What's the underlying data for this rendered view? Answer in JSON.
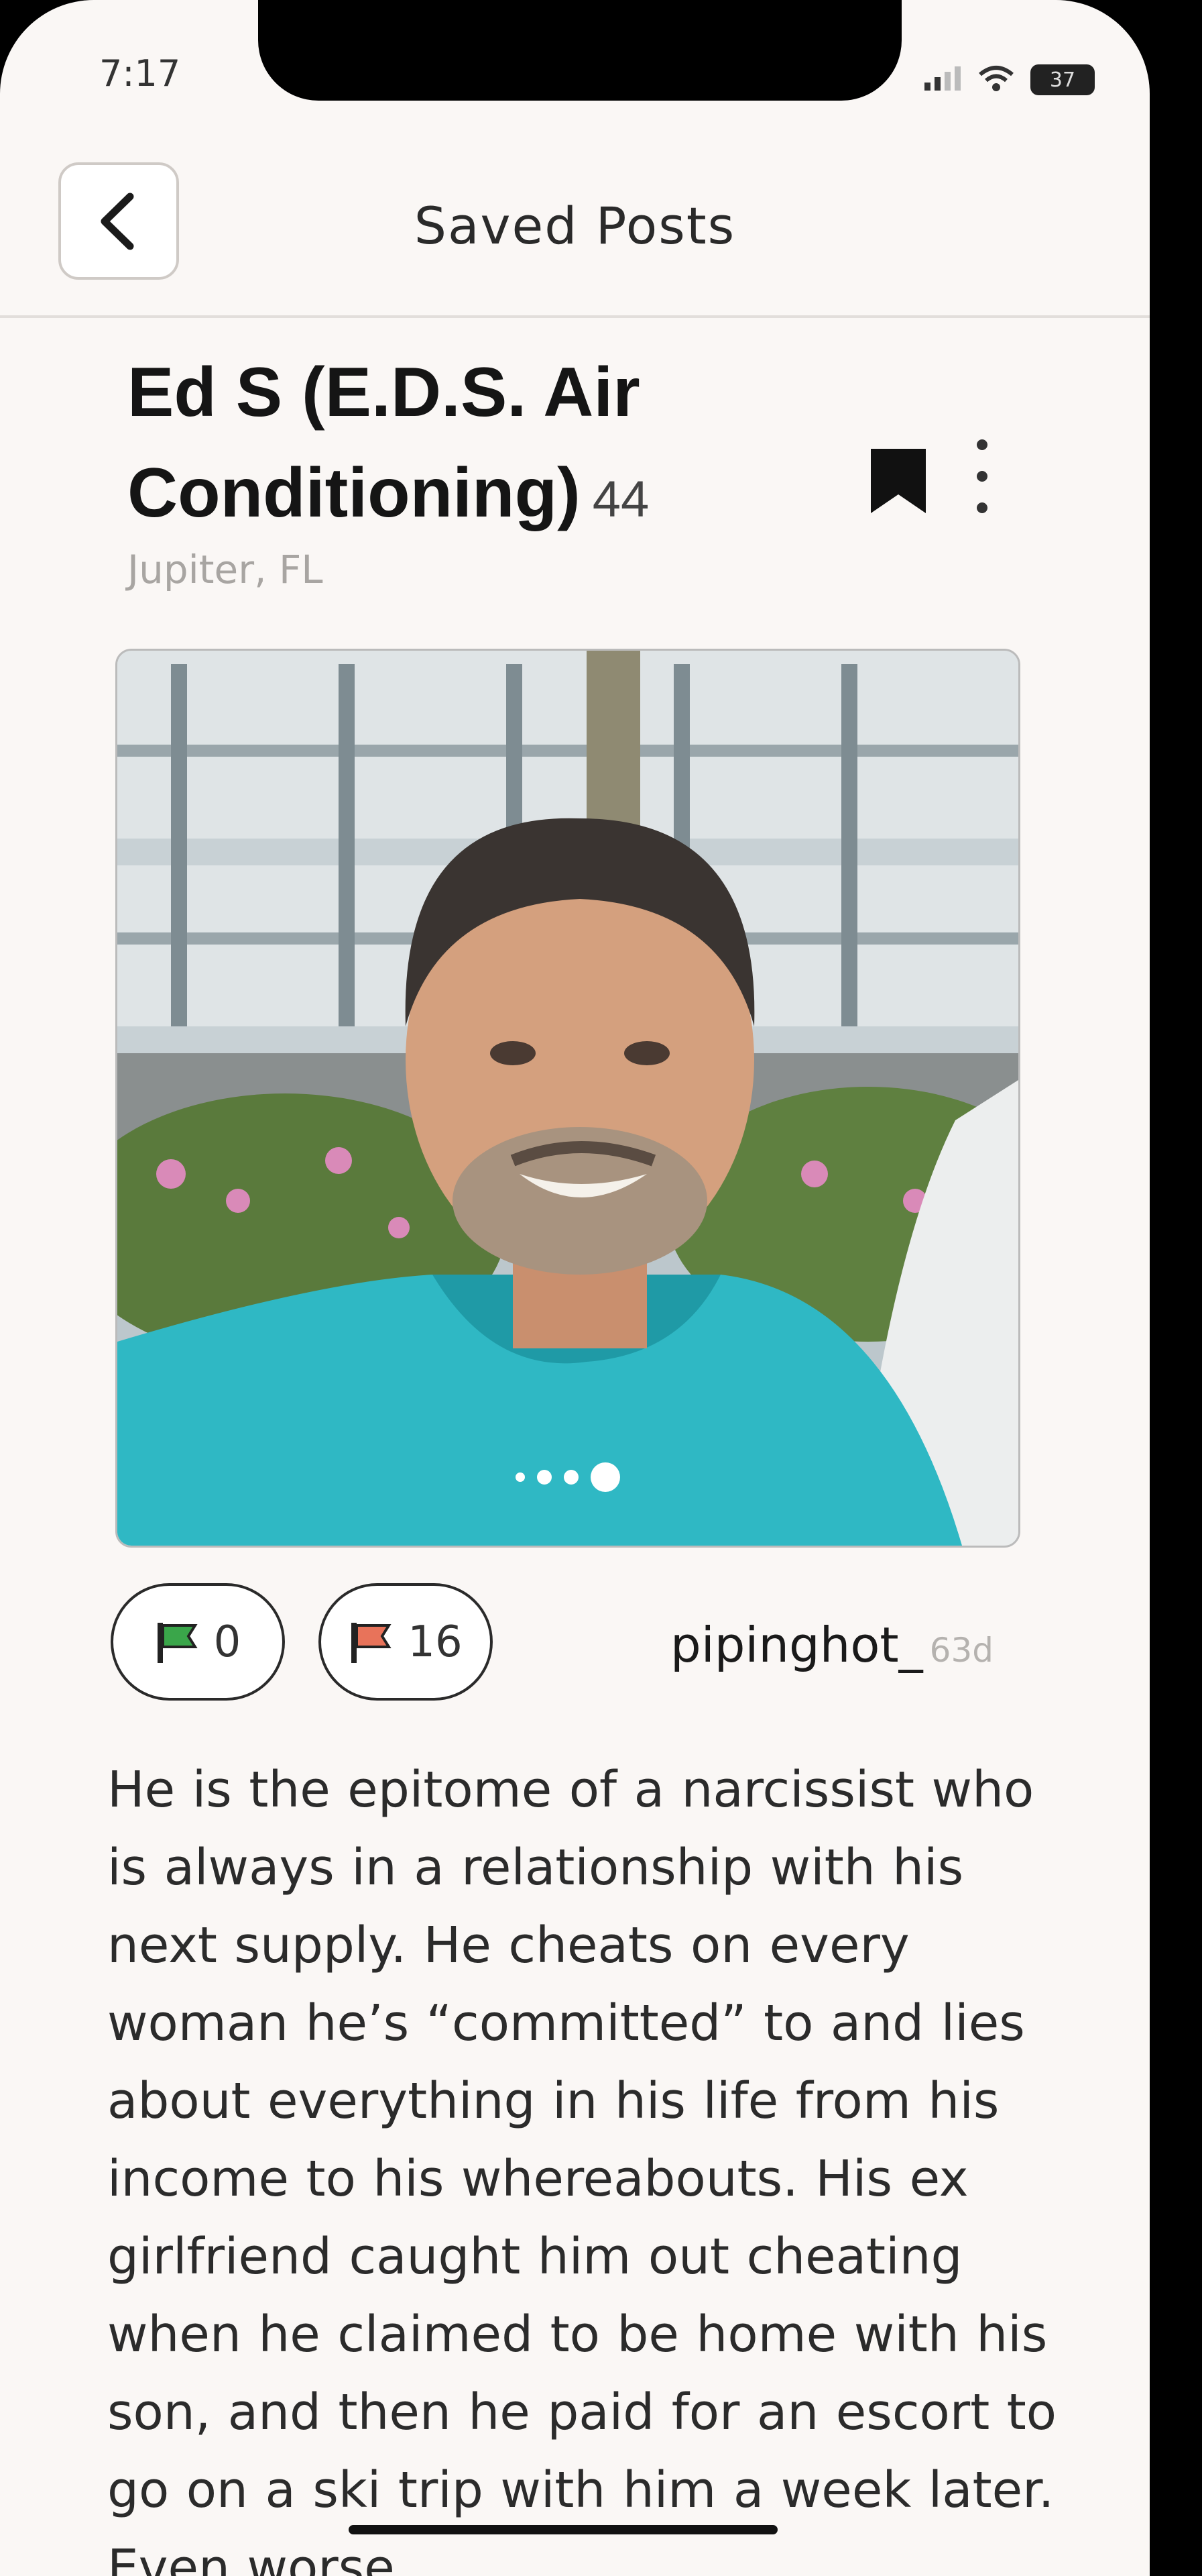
{
  "status_bar": {
    "time": "7:17",
    "battery": "37"
  },
  "header": {
    "title": "Saved Posts",
    "back_icon": "chevron-left-icon"
  },
  "post": {
    "name": "Ed S (E.D.S. Air Conditioning)",
    "age": "44",
    "location": "Jupiter, FL",
    "bookmarked": true,
    "bookmark_icon": "bookmark-filled-icon",
    "more_icon": "vertical-dots-icon",
    "carousel": {
      "count": 4,
      "active_index": 3
    },
    "green_flags": "0",
    "red_flags": "16",
    "author": "pipinghot_",
    "posted_ago": "63d",
    "body": "He is the epitome of a narcissist who is always in a relationship with his next supply. He cheats on every woman he’s “committed” to and lies about everything in his life from his income to his whereabouts. His ex girlfriend caught him out cheating when he claimed to be home with his son, and then he paid for an escort to go on a ski trip with him a week later. Even worse"
  },
  "colors": {
    "green_flag": "#3aa64a",
    "red_flag": "#e8735a",
    "background": "#faf7f5"
  }
}
